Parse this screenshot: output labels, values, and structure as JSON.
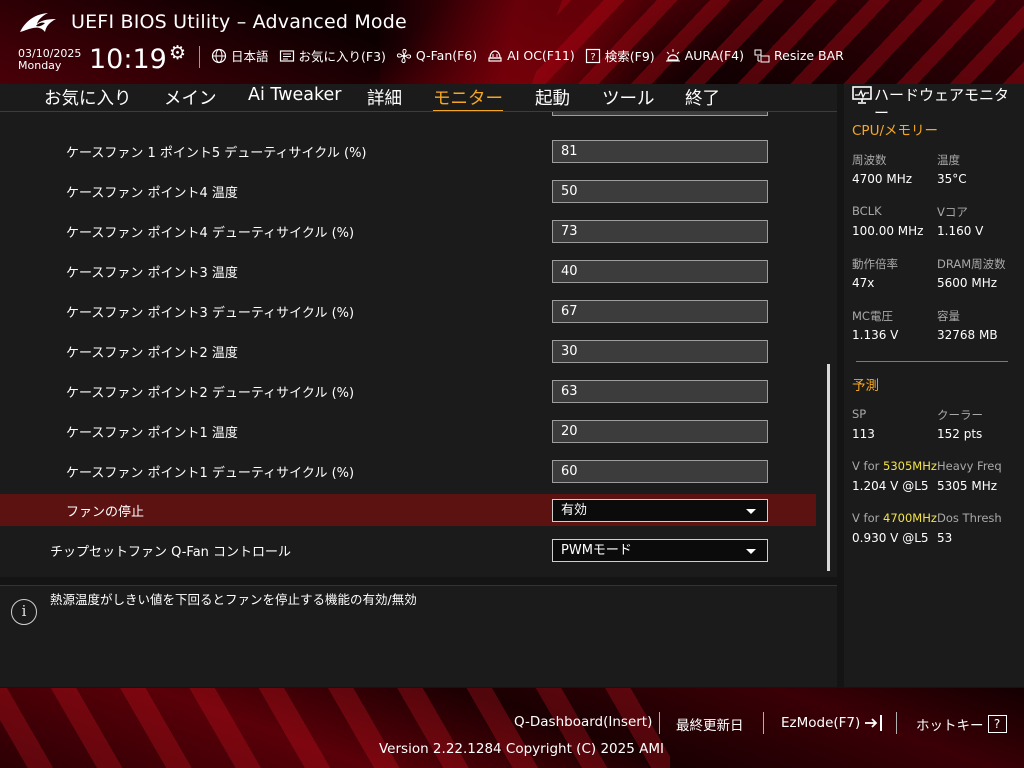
{
  "header": {
    "title": "UEFI BIOS Utility – Advanced Mode",
    "date": "03/10/2025",
    "weekday": "Monday",
    "time": "10:19",
    "toolbar": [
      {
        "icon": "globe-icon",
        "label": "日本語"
      },
      {
        "icon": "favorites-icon",
        "label": "お気に入り(F3)"
      },
      {
        "icon": "fan-icon",
        "label": "Q-Fan(F6)"
      },
      {
        "icon": "ai-oc-icon",
        "label": "AI OC(F11)"
      },
      {
        "icon": "search-icon",
        "label": "検索(F9)"
      },
      {
        "icon": "aura-icon",
        "label": "AURA(F4)"
      },
      {
        "icon": "resize-bar-icon",
        "label": "Resize BAR"
      }
    ]
  },
  "tabs": [
    {
      "label": "お気に入り",
      "active": false
    },
    {
      "label": "メイン",
      "active": false
    },
    {
      "label": "Ai Tweaker",
      "active": false
    },
    {
      "label": "詳細",
      "active": false
    },
    {
      "label": "モニター",
      "active": true
    },
    {
      "label": "起動",
      "active": false
    },
    {
      "label": "ツール",
      "active": false
    },
    {
      "label": "終了",
      "active": false
    }
  ],
  "settings": [
    {
      "label": "ケースファン 1 ポイント5 デューティサイクル (%)",
      "value": "81"
    },
    {
      "label": "ケースファン ポイント4 温度",
      "value": "50"
    },
    {
      "label": "ケースファン ポイント4 デューティサイクル (%)",
      "value": "73"
    },
    {
      "label": "ケースファン ポイント3 温度",
      "value": "40"
    },
    {
      "label": "ケースファン ポイント3 デューティサイクル (%)",
      "value": "67"
    },
    {
      "label": "ケースファン ポイント2 温度",
      "value": "30"
    },
    {
      "label": "ケースファン ポイント2 デューティサイクル (%)",
      "value": "63"
    },
    {
      "label": "ケースファン ポイント1 温度",
      "value": "20"
    },
    {
      "label": "ケースファン ポイント1 デューティサイクル (%)",
      "value": "60"
    },
    {
      "label": "ファンの停止",
      "value": "有効"
    },
    {
      "label": "チップセットファン Q-Fan コントロール",
      "value": "PWMモード"
    }
  ],
  "help": {
    "text": "熱源温度がしきい値を下回るとファンを停止する機能の有効/無効"
  },
  "hw_monitor": {
    "title": "ハードウェアモニター",
    "cpu_section": "CPU/メモリー",
    "cpu": [
      {
        "label": "周波数",
        "value": "4700 MHz"
      },
      {
        "label": "温度",
        "value": "35°C"
      },
      {
        "label": "BCLK",
        "value": "100.00 MHz"
      },
      {
        "label": "Vコア",
        "value": "1.160 V"
      },
      {
        "label": "動作倍率",
        "value": "47x"
      },
      {
        "label": "DRAM周波数",
        "value": "5600 MHz"
      },
      {
        "label": "MC電圧",
        "value": "1.136 V"
      },
      {
        "label": "容量",
        "value": "32768 MB"
      }
    ],
    "prediction_section": "予測",
    "prediction": [
      {
        "label": "SP",
        "value": "113"
      },
      {
        "label": "クーラー",
        "value": "152 pts"
      },
      {
        "label_prefix": "V for ",
        "label_highlight": "5305MHz",
        "value": "1.204 V @L5"
      },
      {
        "label": "Heavy Freq",
        "value": "5305 MHz"
      },
      {
        "label_prefix": "V for ",
        "label_highlight": "4700MHz",
        "value": "0.930 V @L5"
      },
      {
        "label": "Dos Thresh",
        "value": "53"
      }
    ],
    "highlight_color": "#f3e34a"
  },
  "footer": {
    "q_dashboard": "Q-Dashboard(Insert)",
    "last_modified": "最終更新日",
    "ezmode": "EzMode(F7)",
    "hotkeys": "ホットキー",
    "hotkeys_key": "?",
    "version": "Version 2.22.1284 Copyright (C) 2025 AMI"
  },
  "colors": {
    "accent": "#f5a623",
    "highlight_row": "#5d1212"
  }
}
